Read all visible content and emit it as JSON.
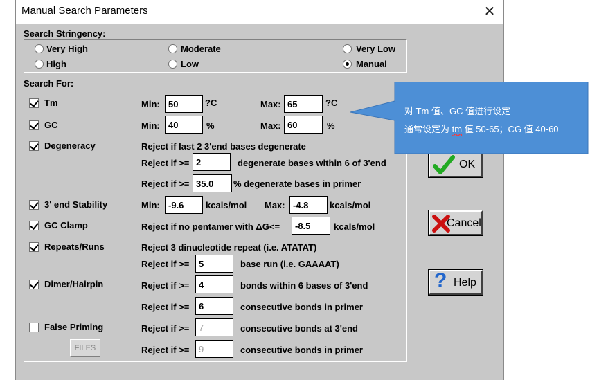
{
  "window": {
    "title": "Manual Search Parameters"
  },
  "stringency": {
    "label": "Search Stringency:",
    "options": [
      "Very High",
      "Moderate",
      "Very Low",
      "High",
      "Low",
      "Manual"
    ],
    "selected": "Manual"
  },
  "search_for": {
    "label": "Search For:",
    "tm": {
      "label": "Tm",
      "checked": true,
      "min_label": "Min:",
      "min": "50",
      "min_unit": "?C",
      "max_label": "Max:",
      "max": "65",
      "max_unit": "?C"
    },
    "gc": {
      "label": "GC",
      "checked": true,
      "min_label": "Min:",
      "min": "40",
      "min_unit": "%",
      "max_label": "Max:",
      "max": "60",
      "max_unit": "%"
    },
    "degeneracy": {
      "label": "Degeneracy",
      "checked": true,
      "line1": "Reject if last 2 3'end bases degenerate",
      "reject_label": "Reject if >=",
      "value1": "2",
      "text1": "degenerate bases within 6 of 3'end",
      "value2": "35.0",
      "text2": "% degenerate bases in primer"
    },
    "stability": {
      "label": "3' end Stability",
      "checked": true,
      "min_label": "Min:",
      "min": "-9.6",
      "unit": "kcals/mol",
      "max_label": "Max:",
      "max": "-4.8"
    },
    "gc_clamp": {
      "label": "GC Clamp",
      "checked": true,
      "text": "Reject if no pentamer with ΔG<=",
      "value": "-8.5",
      "unit": "kcals/mol"
    },
    "repeats": {
      "label": "Repeats/Runs",
      "checked": true,
      "line1": "Reject 3 dinucleotide repeat (i.e. ATATAT)",
      "reject_label": "Reject if >=",
      "value": "5",
      "text": "base run (i.e. GAAAAT)"
    },
    "dimer": {
      "label": "Dimer/Hairpin",
      "checked": true,
      "reject_label": "Reject if >=",
      "value1": "4",
      "text1": "bonds within 6 bases of 3'end",
      "value2": "6",
      "text2": "consecutive bonds in primer"
    },
    "false_priming": {
      "label": "False Priming",
      "checked": false,
      "files_label": "FILES",
      "reject_label": "Reject if >=",
      "value1": "7",
      "text1": "consecutive bonds at 3'end",
      "value2": "9",
      "text2": "consecutive bonds in primer"
    }
  },
  "buttons": {
    "ok": "OK",
    "cancel": "Cancel",
    "help": "Help"
  },
  "callout": {
    "line1": "对 Tm 值、GC 值进行设定",
    "line2_pre": "通常设定为 ",
    "line2_tm": "tm",
    "line2_post": " 值 50-65；CG 值 40-60"
  },
  "colors": {
    "callout_bg": "#4d8fd6",
    "dialog_bg": "#c8c8c8",
    "ok_check": "#22aa22",
    "cancel_x": "#cc1111",
    "help_q": "#2266cc"
  }
}
